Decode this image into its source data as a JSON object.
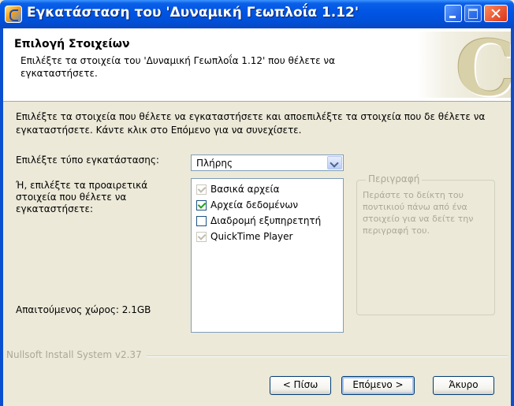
{
  "window": {
    "title": "Εγκατάσταση του 'Δυναμική Γεωπλοΐα 1.12'"
  },
  "header": {
    "title": "Επιλογή Στοιχείων",
    "subtitle": "Επιλέξτε τα στοιχεία του 'Δυναμική Γεωπλοΐα 1.12' που θέλετε να εγκαταστήσετε."
  },
  "body": {
    "intro": "Επιλέξτε τα στοιχεία που θέλετε να εγκαταστήσετε και αποεπιλέξτε τα στοιχεία που δε θέλετε να εγκαταστήσετε. Κάντε κλικ στο Επόμενο για να συνεχίσετε.",
    "install_type_label": "Επιλέξτε τύπο εγκατάστασης:",
    "install_type_value": "Πλήρης",
    "alt_label": "Ή, επιλέξτε τα προαιρετικά στοιχεία που θέλετε να εγκαταστήσετε:",
    "components": [
      {
        "label": "Βασικά αρχεία",
        "checked": true,
        "disabled": true
      },
      {
        "label": "Αρχεία δεδομένων",
        "checked": true,
        "disabled": false
      },
      {
        "label": "Διαδρομή εξυπηρετητή",
        "checked": false,
        "disabled": false
      },
      {
        "label": "QuickTime Player",
        "checked": true,
        "disabled": true
      }
    ],
    "description_title": "Περιγραφή",
    "description_text": "Περάστε το δείκτη του ποντικιού πάνω από ένα στοιχείο για να δείτε την περιγραφή του.",
    "space_required": "Απαιτούμενος χώρος: 2.1GB"
  },
  "footer": {
    "branding": "Nullsoft Install System v2.37",
    "back_label": "< Πίσω",
    "next_label": "Επόμενο >",
    "cancel_label": "Άκυρο"
  }
}
